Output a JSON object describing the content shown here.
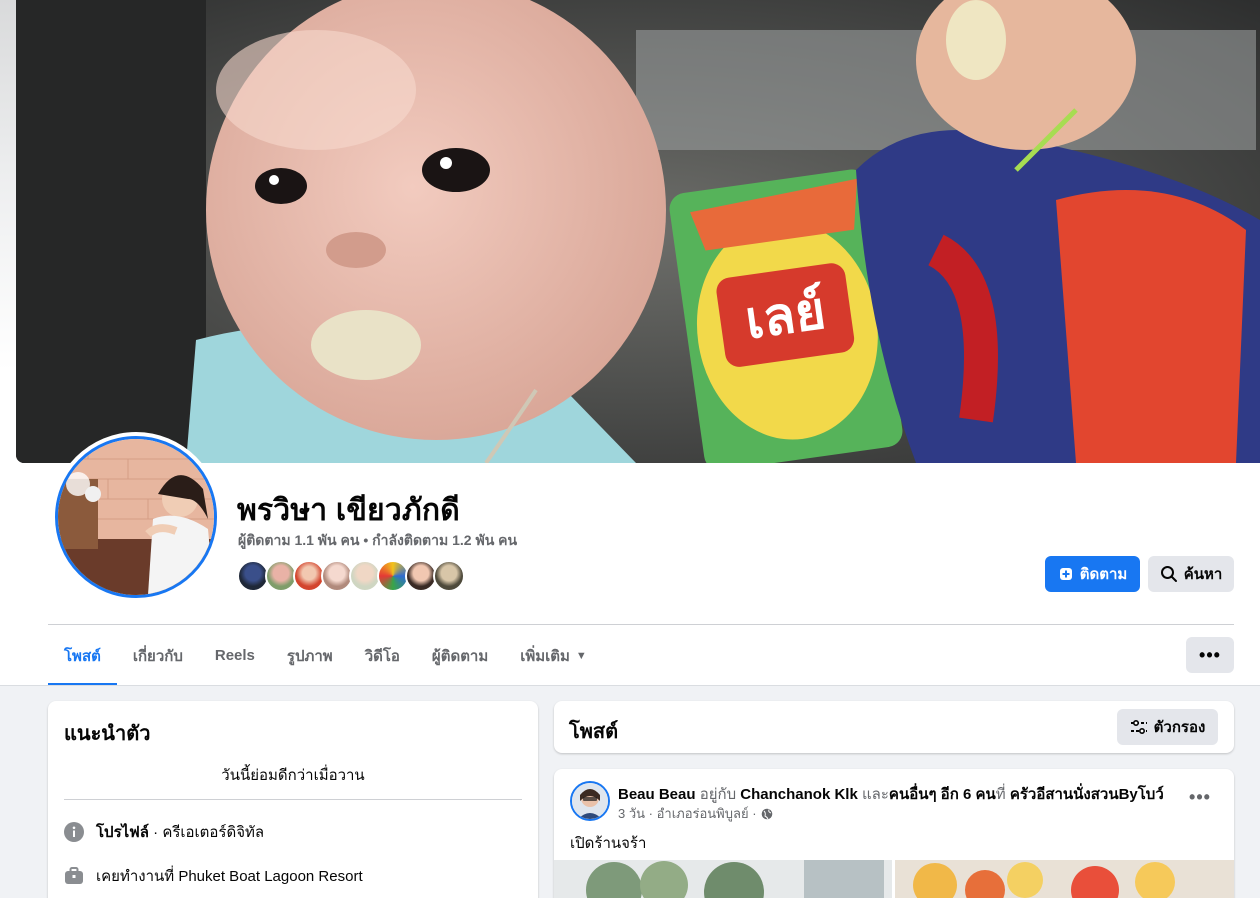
{
  "profile": {
    "name": "พรวิษา เขียวภักดี",
    "followers_text": "ผู้ติดตาม 1.1 พัน คน",
    "bullet": "•",
    "following_text": "กำลังติดตาม 1.2 พัน คน",
    "cover_label": "เลย์"
  },
  "actions": {
    "follow_label": "ติดตาม",
    "search_label": "ค้นหา",
    "more_label": "•••"
  },
  "tabs": [
    {
      "label": "โพสต์",
      "active": true
    },
    {
      "label": "เกี่ยวกับ"
    },
    {
      "label": "Reels"
    },
    {
      "label": "รูปภาพ"
    },
    {
      "label": "วิดีโอ"
    },
    {
      "label": "ผู้ติดตาม"
    },
    {
      "label": "เพิ่มเติม"
    }
  ],
  "intro": {
    "title": "แนะนำตัว",
    "bio": "วันนี้ย่อมดีกว่าเมื่อวาน",
    "rows": [
      {
        "icon": "info-icon",
        "bold": "โปรไฟล์",
        "text": " · ครีเอเตอร์ดิจิทัล"
      },
      {
        "icon": "briefcase-icon",
        "bold": "",
        "text": "เคยทำงานที่ Phuket Boat Lagoon Resort"
      }
    ]
  },
  "posts": {
    "title": "โพสต์",
    "filter_label": "ตัวกรอง",
    "post": {
      "author": "Beau Beau",
      "with_text": " อยู่กับ ",
      "tagged": "Chanchanok Klk",
      "and_text": " และ",
      "others": "คนอื่นๆ อีก 6 คน",
      "at_text": "ที่ ",
      "place": "ครัวอีสานนั่งสวนByโบว์",
      "meta": "3 วัน · อำเภอร่อนพิบูลย์ ·",
      "body": "เปิดร้านจร้า",
      "menu": "•••"
    }
  },
  "colors": {
    "accent": "#1877f2",
    "secondary_button": "#e4e6eb",
    "page_bg": "#f0f2f5"
  }
}
